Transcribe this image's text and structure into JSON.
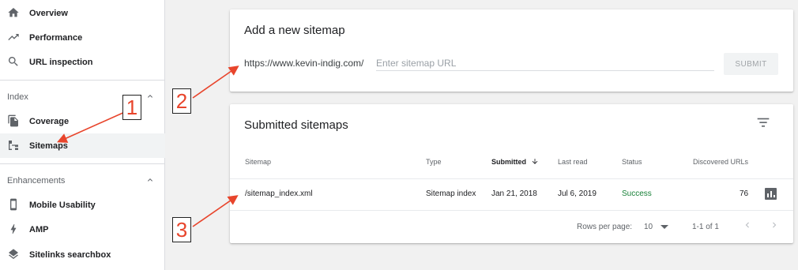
{
  "sidebar": {
    "top_items": [
      {
        "label": "Overview",
        "icon": "home-icon"
      },
      {
        "label": "Performance",
        "icon": "trending-up-icon"
      },
      {
        "label": "URL inspection",
        "icon": "search-icon"
      }
    ],
    "index_section": {
      "heading": "Index",
      "items": [
        {
          "label": "Coverage",
          "icon": "coverage-icon"
        },
        {
          "label": "Sitemaps",
          "icon": "sitemap-icon"
        }
      ]
    },
    "enhancements_section": {
      "heading": "Enhancements",
      "items": [
        {
          "label": "Mobile Usability",
          "icon": "phone-icon"
        },
        {
          "label": "AMP",
          "icon": "bolt-icon"
        },
        {
          "label": "Sitelinks searchbox",
          "icon": "layers-icon"
        }
      ]
    }
  },
  "add_sitemap": {
    "title": "Add a new sitemap",
    "url_prefix": "https://www.kevin-indig.com/",
    "input_placeholder": "Enter sitemap URL",
    "input_value": "",
    "submit_label": "SUBMIT"
  },
  "submitted": {
    "title": "Submitted sitemaps",
    "columns": [
      "Sitemap",
      "Type",
      "Submitted",
      "Last read",
      "Status",
      "Discovered URLs"
    ],
    "rows": [
      {
        "sitemap": "/sitemap_index.xml",
        "type": "Sitemap index",
        "submitted": "Jan 21, 2018",
        "last_read": "Jul 6, 2019",
        "status": "Success",
        "discovered_urls": "76"
      }
    ],
    "footer": {
      "rows_per_page_label": "Rows per page:",
      "rows_per_page_value": "10",
      "range": "1-1 of 1"
    }
  },
  "annotations": [
    "1",
    "2",
    "3"
  ],
  "colors": {
    "accent_red": "#e8452c",
    "success_green": "#188038"
  }
}
